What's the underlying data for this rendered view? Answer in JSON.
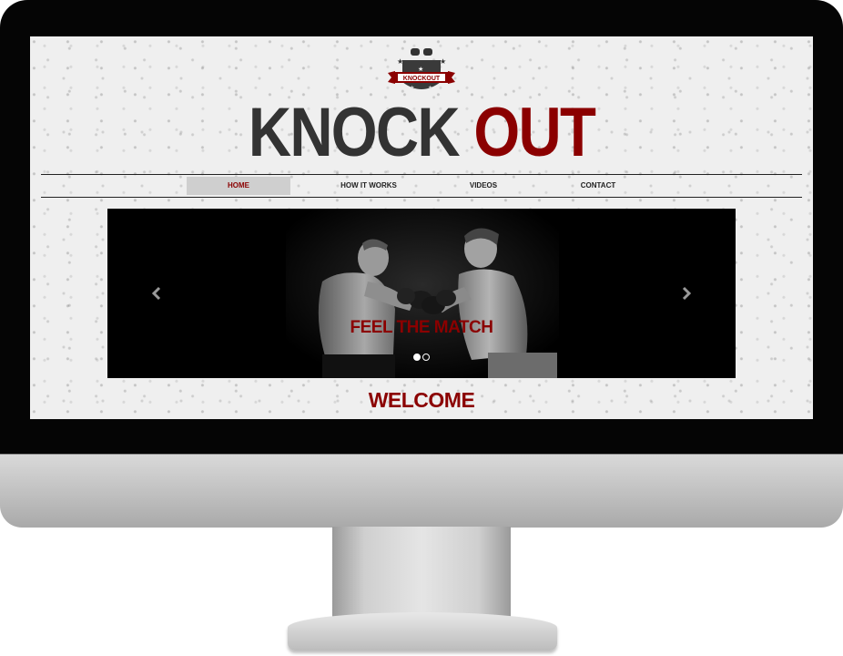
{
  "logo": {
    "text": "KNOCKOUT"
  },
  "site_title": {
    "word1": "KNOCK",
    "word2": "OUT"
  },
  "nav": {
    "items": [
      {
        "label": "HOME",
        "active": true
      },
      {
        "label": "HOW IT WORKS",
        "active": false
      },
      {
        "label": "VIDEOS",
        "active": false
      },
      {
        "label": "CONTACT",
        "active": false
      }
    ]
  },
  "slider": {
    "caption": "FEEL THE MATCH",
    "slide_count": 2,
    "current_slide": 1
  },
  "welcome": {
    "heading": "WELCOME"
  },
  "icons": {
    "logo": "boxing-gloves-emblem-icon",
    "prev": "chevron-left-icon",
    "next": "chevron-right-icon"
  },
  "colors": {
    "accent": "#8b0000",
    "title_dark": "#333333",
    "bezel": "#050505",
    "nav_active_bg": "#cfcfcf"
  }
}
